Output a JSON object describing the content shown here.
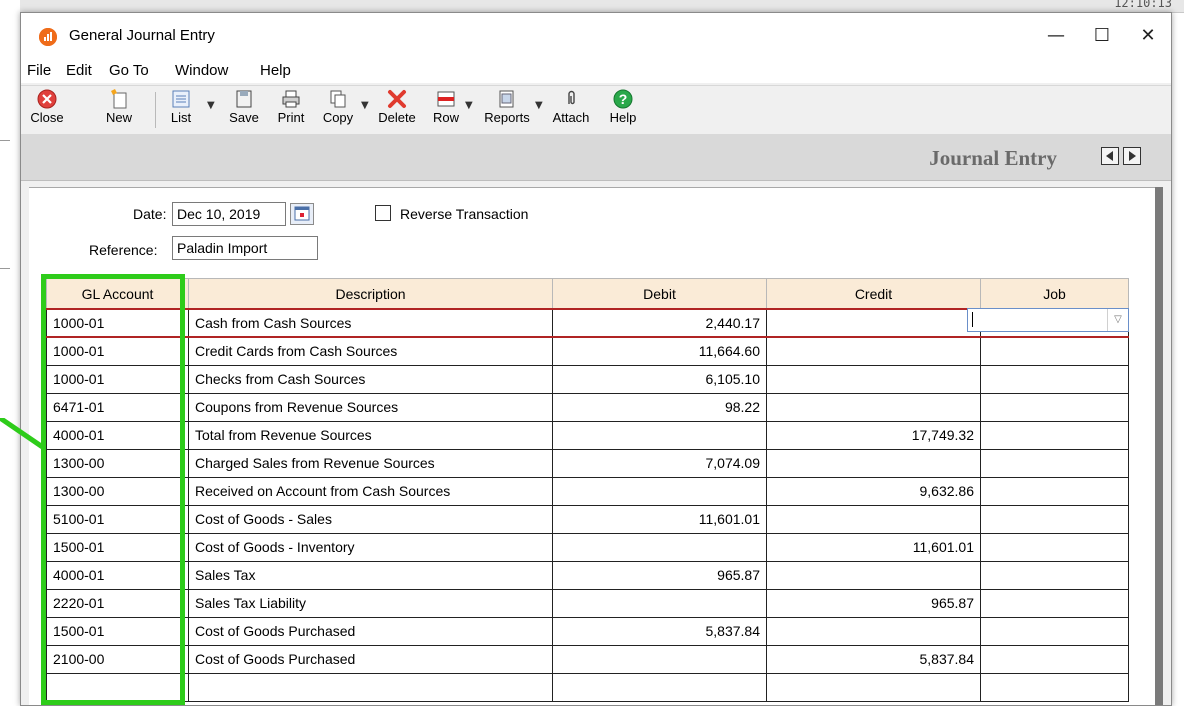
{
  "background": {
    "clock": "12:10:13",
    "colors": {
      "annotation_green": "#2ecc1a"
    }
  },
  "window": {
    "app_icon": "app-logo-icon",
    "title": "General Journal Entry",
    "controls": {
      "minimize": "—",
      "maximize": "☐",
      "close": "✕"
    }
  },
  "menu": [
    "File",
    "Edit",
    "Go To",
    "Window",
    "Help"
  ],
  "toolbar": {
    "close": "Close",
    "new": "New",
    "list": "List",
    "save": "Save",
    "print": "Print",
    "copy": "Copy",
    "delete": "Delete",
    "row": "Row",
    "reports": "Reports",
    "attach": "Attach",
    "help": "Help",
    "icons": [
      "close-circle-icon",
      "new-doc-icon",
      "list-icon",
      "save-disk-icon",
      "printer-icon",
      "copy-icon",
      "delete-x-icon",
      "row-icon",
      "reports-icon",
      "paperclip-icon",
      "help-circle-icon"
    ]
  },
  "header": {
    "title": "Journal Entry",
    "prev": "previous-arrow-icon",
    "next": "next-arrow-icon"
  },
  "form": {
    "date_label": "Date:",
    "date_value": "Dec 10, 2019",
    "reverse_label": "Reverse Transaction",
    "reverse_checked": false,
    "reference_label": "Reference:",
    "reference_value": "Paladin Import"
  },
  "grid": {
    "columns": [
      "GL Account",
      "Description",
      "Debit",
      "Credit",
      "Job"
    ],
    "rows": [
      {
        "account": "1000-01",
        "description": "Cash from Cash Sources",
        "debit": "2,440.17",
        "credit": "",
        "job": ""
      },
      {
        "account": "1000-01",
        "description": "Credit Cards from Cash Sources",
        "debit": "11,664.60",
        "credit": "",
        "job": ""
      },
      {
        "account": "1000-01",
        "description": "Checks from Cash Sources",
        "debit": "6,105.10",
        "credit": "",
        "job": ""
      },
      {
        "account": "6471-01",
        "description": "Coupons from Revenue Sources",
        "debit": "98.22",
        "credit": "",
        "job": ""
      },
      {
        "account": "4000-01",
        "description": "Total from Revenue Sources",
        "debit": "",
        "credit": "17,749.32",
        "job": ""
      },
      {
        "account": "1300-00",
        "description": "Charged Sales from Revenue Sources",
        "debit": "7,074.09",
        "credit": "",
        "job": ""
      },
      {
        "account": "1300-00",
        "description": "Received on Account from Cash Sources",
        "debit": "",
        "credit": "9,632.86",
        "job": ""
      },
      {
        "account": "5100-01",
        "description": "Cost of Goods - Sales",
        "debit": "11,601.01",
        "credit": "",
        "job": ""
      },
      {
        "account": "1500-01",
        "description": "Cost of Goods - Inventory",
        "debit": "",
        "credit": "11,601.01",
        "job": ""
      },
      {
        "account": "4000-01",
        "description": "Sales Tax",
        "debit": "965.87",
        "credit": "",
        "job": ""
      },
      {
        "account": "2220-01",
        "description": "Sales Tax Liability",
        "debit": "",
        "credit": "965.87",
        "job": ""
      },
      {
        "account": "1500-01",
        "description": "Cost of Goods Purchased",
        "debit": "5,837.84",
        "credit": "",
        "job": ""
      },
      {
        "account": "2100-00",
        "description": "Cost of Goods Purchased",
        "debit": "",
        "credit": "5,837.84",
        "job": ""
      },
      {
        "account": "",
        "description": "",
        "debit": "",
        "credit": "",
        "job": ""
      }
    ]
  }
}
